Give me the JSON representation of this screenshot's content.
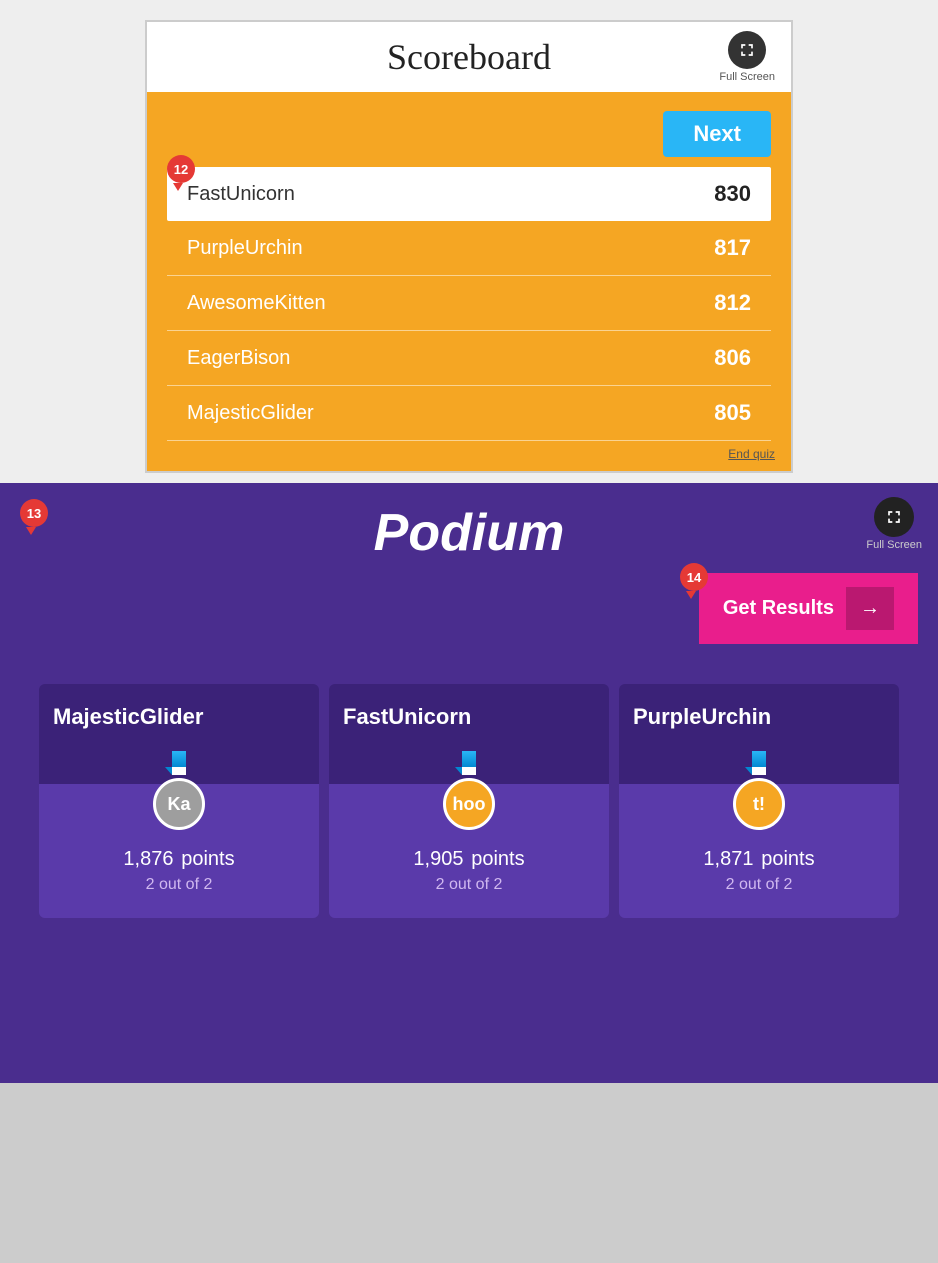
{
  "scoreboard": {
    "title": "Scoreboard",
    "fullscreen_label": "Full Screen",
    "next_label": "Next",
    "badge_number": "12",
    "end_quiz_label": "End quiz",
    "rows": [
      {
        "name": "FastUnicorn",
        "score": "830",
        "first": true
      },
      {
        "name": "PurpleUrchin",
        "score": "817",
        "first": false
      },
      {
        "name": "AwesomeKitten",
        "score": "812",
        "first": false
      },
      {
        "name": "EagerBison",
        "score": "806",
        "first": false
      },
      {
        "name": "MajesticGlider",
        "score": "805",
        "first": false
      }
    ]
  },
  "podium": {
    "title": "Podium",
    "fullscreen_label": "Full Screen",
    "badge_number_13": "13",
    "badge_number_14": "14",
    "get_results_label": "Get Results",
    "players": [
      {
        "name": "MajesticGlider",
        "avatar_text": "Ka",
        "avatar_class": "avatar-ka",
        "points": "1,876",
        "points_label": "points",
        "out_of": "2 out of 2"
      },
      {
        "name": "FastUnicorn",
        "avatar_text": "hoo",
        "avatar_class": "avatar-hoo",
        "points": "1,905",
        "points_label": "points",
        "out_of": "2 out of 2"
      },
      {
        "name": "PurpleUrchin",
        "avatar_text": "t!",
        "avatar_class": "avatar-ti",
        "points": "1,871",
        "points_label": "points",
        "out_of": "2 out of 2"
      }
    ]
  }
}
